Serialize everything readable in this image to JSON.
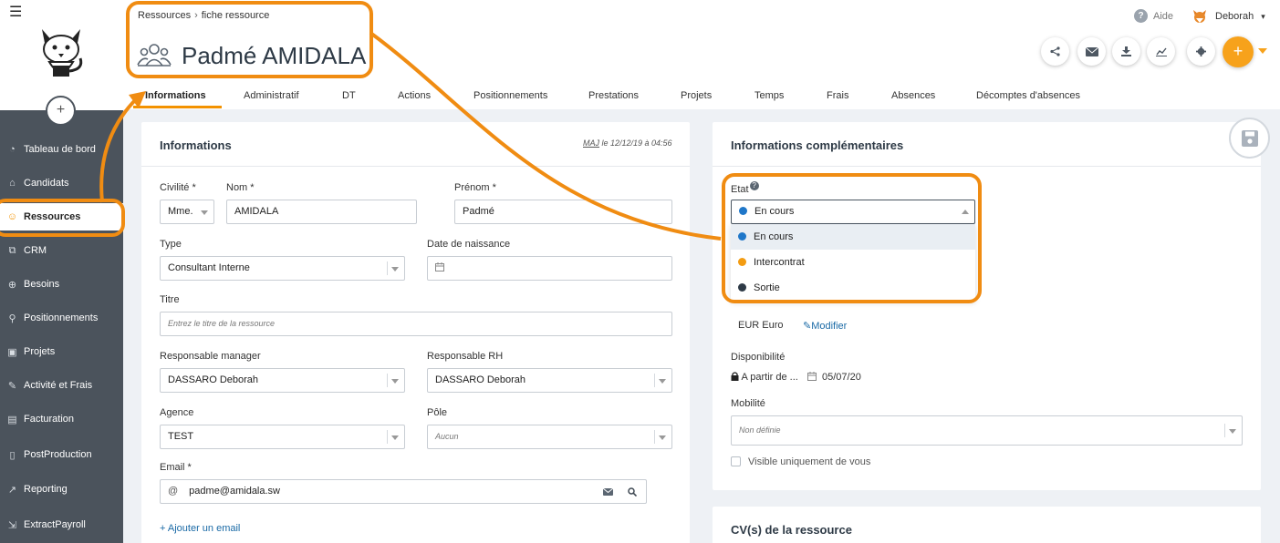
{
  "sidebar": {
    "add_label": "+",
    "items": [
      {
        "label": "Tableau de bord",
        "icon": "dashboard-icon",
        "glyph": "◔"
      },
      {
        "label": "Candidats",
        "icon": "graduation-icon",
        "glyph": "⌂"
      },
      {
        "label": "Ressources",
        "icon": "users-icon",
        "glyph": "☺"
      },
      {
        "label": "CRM",
        "icon": "sitemap-icon",
        "glyph": "⧉"
      },
      {
        "label": "Besoins",
        "icon": "target-icon",
        "glyph": "⊕"
      },
      {
        "label": "Positionnements",
        "icon": "pin-icon",
        "glyph": "⚲"
      },
      {
        "label": "Projets",
        "icon": "briefcase-icon",
        "glyph": "▣"
      },
      {
        "label": "Activité et Frais",
        "icon": "edit-icon",
        "glyph": "✎"
      },
      {
        "label": "Facturation",
        "icon": "invoice-icon",
        "glyph": "▤"
      },
      {
        "label": "PostProduction",
        "icon": "file-icon",
        "glyph": "▯"
      },
      {
        "label": "Reporting",
        "icon": "line-chart-icon",
        "glyph": "↗"
      },
      {
        "label": "ExtractPayroll",
        "icon": "export-icon",
        "glyph": "⇲"
      }
    ]
  },
  "header": {
    "breadcrumb": [
      "Ressources",
      "fiche ressource"
    ],
    "breadcrumb_sep": "›",
    "title": "Padmé AMIDALA",
    "help_label": "Aide",
    "user_name": "Deborah",
    "user_caret": "▾",
    "plus_label": "+"
  },
  "tabs": [
    "Informations",
    "Administratif",
    "DT",
    "Actions",
    "Positionnements",
    "Prestations",
    "Projets",
    "Temps",
    "Frais",
    "Absences",
    "Décomptes d'absences"
  ],
  "informations": {
    "title": "Informations",
    "maj_prefix": "MAJ",
    "maj_text": " le 12/12/19 à 04:56",
    "civilite_label": "Civilité *",
    "civilite_value": "Mme.",
    "nom_label": "Nom *",
    "nom_value": "AMIDALA",
    "prenom_label": "Prénom *",
    "prenom_value": "Padmé",
    "type_label": "Type",
    "type_value": "Consultant Interne",
    "naissance_label": "Date de naissance",
    "titre_label": "Titre",
    "titre_placeholder": "Entrez le titre de la ressource",
    "resp_manager_label": "Responsable manager",
    "resp_manager_value": "DASSARO Deborah",
    "resp_rh_label": "Responsable RH",
    "resp_rh_value": "DASSARO Deborah",
    "agence_label": "Agence",
    "agence_value": "TEST",
    "pole_label": "Pôle",
    "pole_placeholder": "Aucun",
    "email_label": "Email *",
    "email_prefix": "@",
    "email_value": "padme@amidala.sw",
    "add_email": "+ Ajouter un email"
  },
  "complementaires": {
    "title": "Informations complémentaires",
    "etat_label": "Etat",
    "etat_help": "?",
    "etat_selected": "En cours",
    "etat_options": [
      {
        "label": "En cours",
        "color": "#1f77c9"
      },
      {
        "label": "Intercontrat",
        "color": "#f39c12"
      },
      {
        "label": "Sortie",
        "color": "#2e3a46"
      }
    ],
    "currency": "EUR Euro",
    "modifier": "Modifier",
    "dispo_label": "Disponibilité",
    "dispo_mode": "A partir de ...",
    "dispo_date": "05/07/20",
    "mobilite_label": "Mobilité",
    "mobilite_placeholder": "Non définie",
    "visible_label": "Visible uniquement de vous"
  },
  "cv": {
    "title": "CV(s) de la ressource"
  },
  "colors": {
    "accent": "#f39200",
    "sidebar": "#4b535c",
    "annotation": "#f08c12"
  }
}
